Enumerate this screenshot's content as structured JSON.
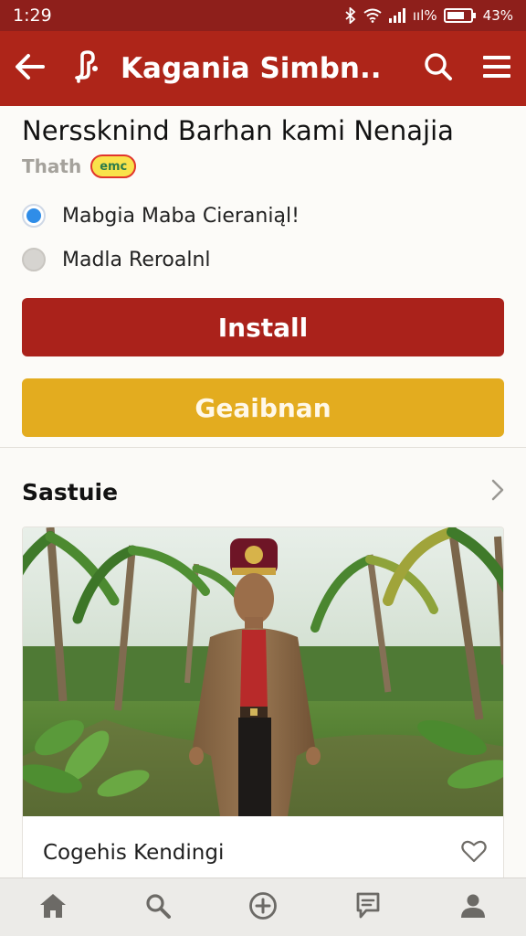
{
  "status": {
    "time": "1:29",
    "battery": "43%",
    "data": "ııl%"
  },
  "app_bar": {
    "title": "Kagania Simbn.."
  },
  "listing": {
    "name": "Nerssknind Barhan kami Nenajia",
    "publisher": "Thath",
    "badge": "emc",
    "options": [
      {
        "label": "Mabgia Maba Cieraniąl!",
        "selected": true
      },
      {
        "label": "Madla Reroalnl",
        "selected": false
      }
    ],
    "install_label": "Install",
    "secondary_label": "Geaibnan"
  },
  "section": {
    "title": "Sastuie"
  },
  "photo_card": {
    "caption": "Cogehis Kendingi"
  },
  "colors": {
    "app_bar": "#ae2519",
    "install": "#aa221b",
    "secondary": "#e3ac1f",
    "radio_on": "#2f8de8"
  },
  "icons": {
    "app_bar": [
      "back-arrow-icon",
      "app-logo-icon",
      "search-icon",
      "menu-icon"
    ],
    "bottom_nav": [
      "home-icon",
      "search-icon",
      "add-circle-icon",
      "messages-icon",
      "profile-icon"
    ]
  }
}
